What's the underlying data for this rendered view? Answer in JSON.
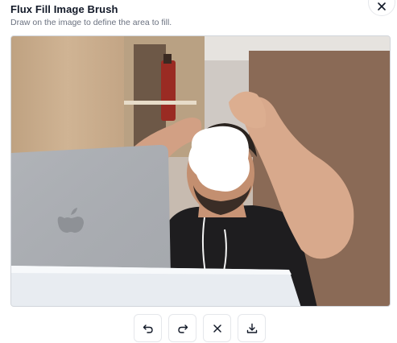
{
  "dialog": {
    "title": "Flux Fill Image Brush",
    "subtitle": "Draw on the image to define the area to fill.",
    "close_icon": "close-icon"
  },
  "canvas": {
    "image_description_icon": "photo-canvas",
    "mask_color": "#ffffff"
  },
  "toolbar": {
    "buttons": [
      {
        "name": "undo-button",
        "icon": "undo-icon"
      },
      {
        "name": "redo-button",
        "icon": "redo-icon"
      },
      {
        "name": "clear-button",
        "icon": "close-icon"
      },
      {
        "name": "download-button",
        "icon": "download-icon"
      }
    ]
  },
  "colors": {
    "title": "#111827",
    "subtitle": "#6b7280",
    "border": "#e5e7eb"
  }
}
